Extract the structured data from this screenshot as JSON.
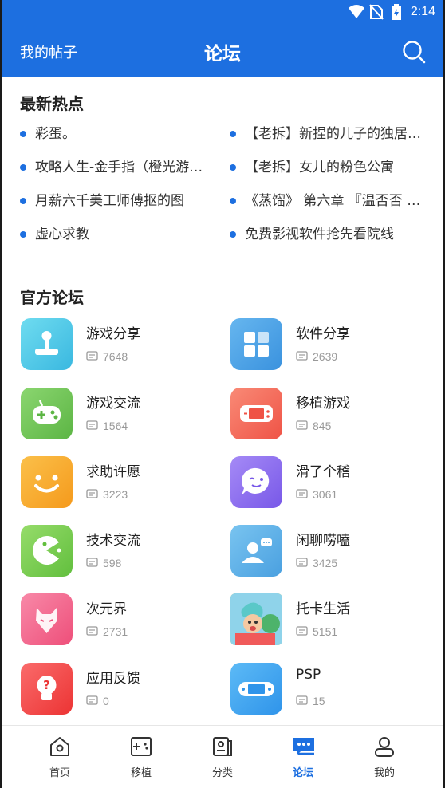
{
  "status": {
    "time": "2:14"
  },
  "header": {
    "left_link": "我的帖子",
    "title": "论坛"
  },
  "hot": {
    "title": "最新热点",
    "items": [
      "彩蛋。",
      "【老拆】新捏的儿子的独居…",
      "攻略人生-金手指（橙光游…",
      "【老拆】女儿的粉色公寓",
      "月薪六千美工师傅抠的图",
      "《蒸馏》 第六章 『温否否 …",
      "虚心求教",
      "免费影视软件抢先看院线"
    ]
  },
  "official": {
    "title": "官方论坛",
    "forums": [
      {
        "name": "游戏分享",
        "count": "7648",
        "icon": "joystick-icon",
        "color": "#4fc8e6"
      },
      {
        "name": "软件分享",
        "count": "2639",
        "icon": "apps-grid-icon",
        "color": "#3f9de3"
      },
      {
        "name": "游戏交流",
        "count": "1564",
        "icon": "gamepad-icon",
        "color": "#72c35a"
      },
      {
        "name": "移植游戏",
        "count": "845",
        "icon": "handheld-console-icon",
        "color": "#f46a5e"
      },
      {
        "name": "求助许愿",
        "count": "3223",
        "icon": "smile-icon",
        "color": "#f8a92e"
      },
      {
        "name": "滑了个稽",
        "count": "3061",
        "icon": "wink-bubble-icon",
        "color": "#8b6cf0"
      },
      {
        "name": "技术交流",
        "count": "598",
        "icon": "pacman-icon",
        "color": "#79cd53"
      },
      {
        "name": "闲聊唠嗑",
        "count": "3425",
        "icon": "chat-person-icon",
        "color": "#4aa9e8"
      },
      {
        "name": "次元界",
        "count": "2731",
        "icon": "fox-mask-icon",
        "color": "#f3618a"
      },
      {
        "name": "托卡生活",
        "count": "5151",
        "icon": "toca-life-icon",
        "color": "#f0c94a"
      },
      {
        "name": "应用反馈",
        "count": "0",
        "icon": "lightbulb-question-icon",
        "color": "#f44a4a"
      },
      {
        "name": "PSP",
        "count": "15",
        "icon": "psp-icon",
        "color": "#3ea6f2"
      }
    ]
  },
  "nav": [
    {
      "label": "首页",
      "icon": "home-icon",
      "active": false
    },
    {
      "label": "移植",
      "icon": "port-gamepad-icon",
      "active": false
    },
    {
      "label": "分类",
      "icon": "category-icon",
      "active": false
    },
    {
      "label": "论坛",
      "icon": "forum-icon",
      "active": true
    },
    {
      "label": "我的",
      "icon": "profile-icon",
      "active": false
    }
  ],
  "colors": {
    "primary": "#1d6fe0"
  }
}
